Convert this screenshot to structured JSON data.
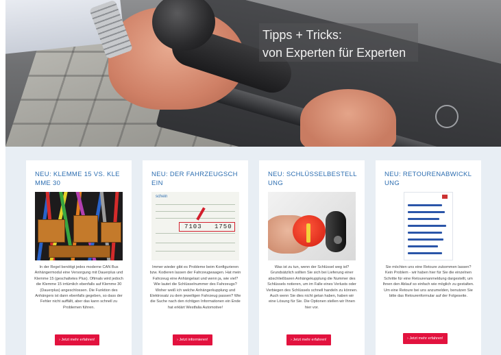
{
  "hero": {
    "title_line1": "Tipps + Tricks:",
    "title_line2": "von Experten für Experten"
  },
  "cards": [
    {
      "title": "NEU: KLEMME 15 VS. KLEMME 30",
      "text": "In der Regel benötigt jedes moderne CAN Bus Anhängermodul eine Versorgung mit Dauerplus und Klemme 15 (geschaltetes Plus). Oftmals wird jedoch die Klemme 15 irrtümlich ebenfalls auf Klemme 30 (Dauerplus) angeschlossen. Die Funktion des Anhängers ist dann ebenfalls gegeben, so dass der Fehler nicht auffällt, aber das kann schnell zu Problemen führen.",
      "button": "› Jetzt mehr erfahren!"
    },
    {
      "title": "NEU: DER FAHRZEUGSCHEIN",
      "text": "Immer wieder gibt es Probleme beim Konfigurieren bzw. Kodieren lassen der Fahrzeugwaagen. Hat mein Fahrzeug eine Anhängelast und wenn ja, wie viel? Wie lautet die Schlüsselnummer des Fahrzeugs? Woher weiß ich welche Anhängerkupplung und Elektrosatz zu dem jeweiligen Fahrzeug passen? Wie die Suche nach den richtigen Informationen ein Ende hat erklärt Westfalia Automotive!",
      "button": "› Jetzt informieren!"
    },
    {
      "title": "NEU: SCHLÜSSELBESTELLUNG",
      "text": "Was ist zu tun, wenn der Schlüssel weg ist? Grundsätzlich sollten Sie sich bei Lieferung einer abschließbaren Anhängekupplung die Nummer des Schlüssels notieren, um im Falle eines Verlusts oder Verbiegen des Schlüssels schnell handeln zu können. Auch wenn Sie dies nicht getan haben, haben wir eine Lösung für Sie. Die Optionen stellen wir Ihnen hier vor.",
      "button": "› Jetzt mehr erfahren!"
    },
    {
      "title": "NEU: RETOURENABWICKLUNG",
      "text": "Sie möchten uns eine Retoure zukommen lassen? Kein Problem - wir haben hier für Sie die einzelnen Schritte für eine Retourenanmeldung dargestellt, um Ihnen den Ablauf so einfach wie möglich zu gestalten. Um eine Retoure bei uns anzumelden, benutzen Sie bitte das Retourenformular auf der Folgeseite.",
      "button": "› Jetzt mehr erfahren!"
    }
  ],
  "thumbs": {
    "doc_number_left": "7103",
    "doc_number_right": "1750",
    "doc_header": "schein"
  }
}
